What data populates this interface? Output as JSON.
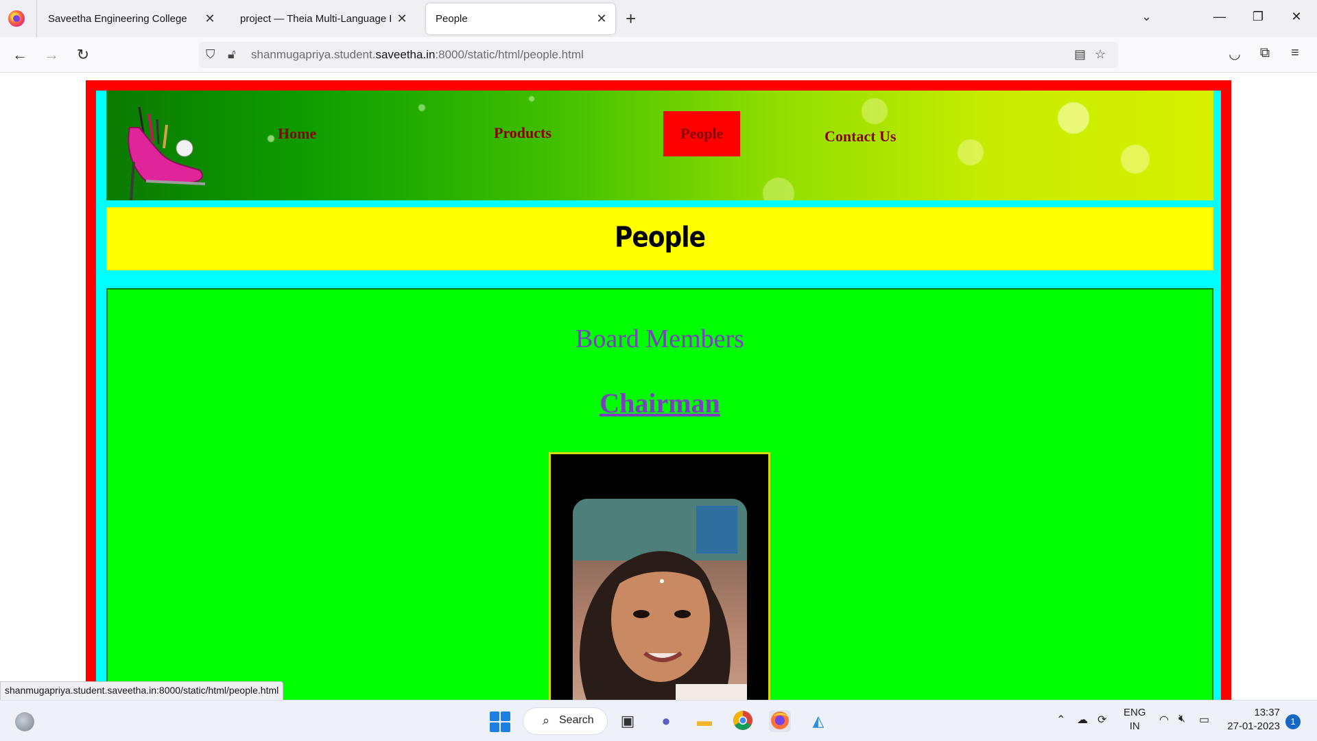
{
  "browser": {
    "tabs": [
      {
        "title": "Saveetha Engineering College"
      },
      {
        "title": "project — Theia Multi-Language Ex"
      },
      {
        "title": "People"
      }
    ],
    "new_tab_label": "+",
    "url": {
      "prefix": "shanmugapriya.student.",
      "host": "saveetha.in",
      "suffix": ":8000/static/html/people.html"
    },
    "status_url": "shanmugapriya.student.saveetha.in:8000/static/html/people.html"
  },
  "site": {
    "nav": [
      {
        "label": "Home",
        "active": false
      },
      {
        "label": "Products",
        "active": false
      },
      {
        "label": "People",
        "active": true
      },
      {
        "label": "Contact Us",
        "active": false
      }
    ],
    "page_title": "People",
    "section_title": "Board Members",
    "role_title": "Chairman",
    "colors": {
      "outer_border": "#ff0000",
      "inner_border": "#00ffff",
      "title_band": "#ffff00",
      "content_bg": "#00ff00",
      "nav_text": "#8b0000",
      "heading_text": "#7b3fbf"
    }
  },
  "taskbar": {
    "search_label": "Search",
    "lang_primary": "ENG",
    "lang_secondary": "IN",
    "time": "13:37",
    "date": "27-01-2023",
    "notification_count": "1",
    "icons": [
      "windows-start-icon",
      "search-icon",
      "task-view-icon",
      "teams-chat-icon",
      "file-explorer-icon",
      "chrome-icon",
      "firefox-icon",
      "photos-icon"
    ]
  }
}
